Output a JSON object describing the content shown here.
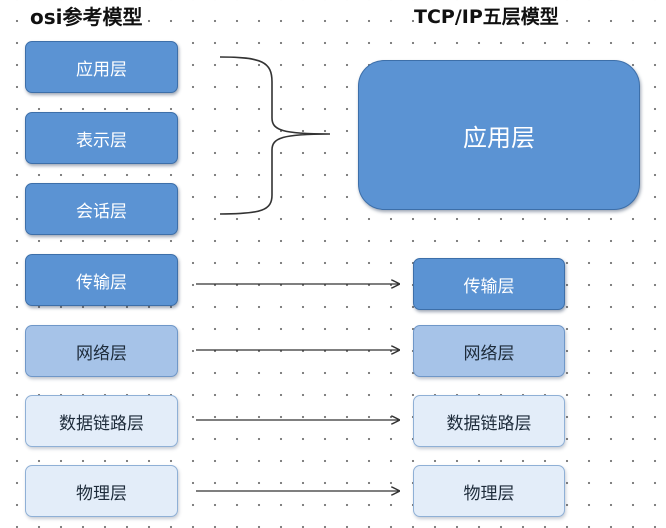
{
  "titles": {
    "osi": "osi参考模型",
    "tcpip": "TCP/IP五层模型"
  },
  "osi_layers": [
    {
      "label": "应用层",
      "shade": "dark"
    },
    {
      "label": "表示层",
      "shade": "dark"
    },
    {
      "label": "会话层",
      "shade": "dark"
    },
    {
      "label": "传输层",
      "shade": "dark"
    },
    {
      "label": "网络层",
      "shade": "mid"
    },
    {
      "label": "数据链路层",
      "shade": "light"
    },
    {
      "label": "物理层",
      "shade": "light"
    }
  ],
  "tcpip_layers": [
    {
      "label": "应用层",
      "shade": "dark"
    },
    {
      "label": "传输层",
      "shade": "dark"
    },
    {
      "label": "网络层",
      "shade": "mid"
    },
    {
      "label": "数据链路层",
      "shade": "light"
    },
    {
      "label": "物理层",
      "shade": "light"
    }
  ],
  "colors": {
    "dark": "#5b93d3",
    "mid": "#a6c3e8",
    "light": "#e3edf9",
    "connector": "#333333"
  }
}
